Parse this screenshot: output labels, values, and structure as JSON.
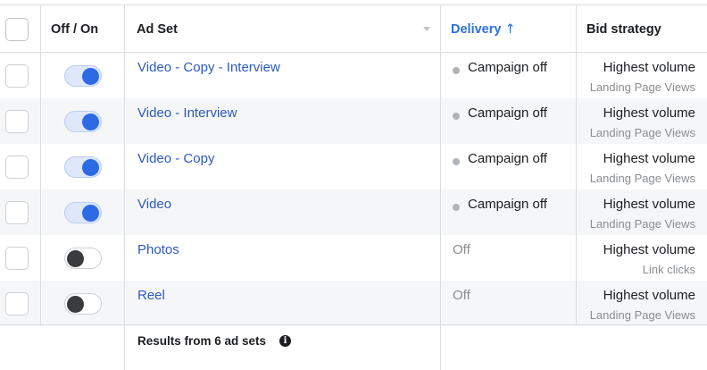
{
  "header": {
    "off_on": "Off / On",
    "ad_set": "Ad Set",
    "delivery": "Delivery",
    "delivery_arrow": "↑",
    "bid_strategy": "Bid strategy"
  },
  "rows": [
    {
      "name": "Video - Copy - Interview",
      "toggle": "on",
      "delivery": "Campaign off",
      "bid": "Highest volume",
      "bid_sub": "Landing Page Views"
    },
    {
      "name": "Video - Interview",
      "toggle": "on",
      "delivery": "Campaign off",
      "bid": "Highest volume",
      "bid_sub": "Landing Page Views"
    },
    {
      "name": "Video - Copy",
      "toggle": "on",
      "delivery": "Campaign off",
      "bid": "Highest volume",
      "bid_sub": "Landing Page Views"
    },
    {
      "name": "Video",
      "toggle": "on",
      "delivery": "Campaign off",
      "bid": "Highest volume",
      "bid_sub": "Landing Page Views"
    },
    {
      "name": "Photos",
      "toggle": "off",
      "delivery": "Off",
      "bid": "Highest volume",
      "bid_sub": "Link clicks"
    },
    {
      "name": "Reel",
      "toggle": "off",
      "delivery": "Off",
      "bid": "Highest volume",
      "bid_sub": "Landing Page Views"
    }
  ],
  "footer": {
    "results": "Results from 6 ad sets",
    "info_icon": "i"
  },
  "colors": {
    "link": "#2c59c4",
    "toggle_on": "#2d6be4",
    "toggle_off_knob": "#3a3b3c",
    "delivery_dot": "#b0b3b8"
  },
  "icons": {
    "sort": "sort-caret-icon",
    "delivery_sort": "arrow-up-icon",
    "info": "info-icon"
  }
}
